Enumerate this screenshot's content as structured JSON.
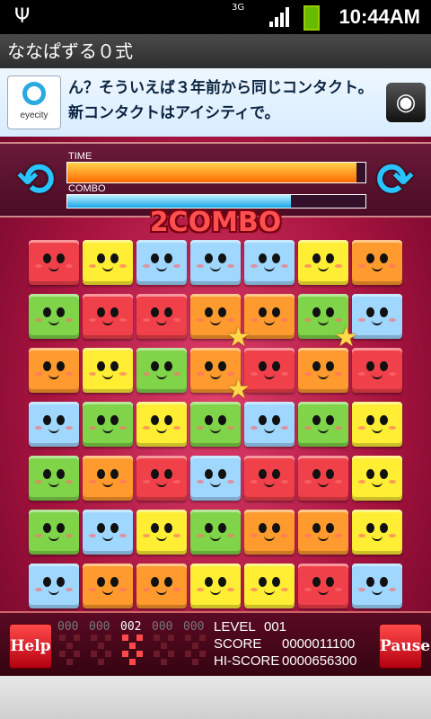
{
  "status_bar": {
    "time": "10:44AM",
    "network": "3G"
  },
  "app": {
    "title": "ななぱずる０式"
  },
  "ad": {
    "logo_text": "eyecity",
    "message": "ん？そういえば３年前から同じコンタクト。新コンタクトはアイシティで。"
  },
  "hud": {
    "time_label": "TIME",
    "time_level": 0.97,
    "combo_label": "COMBO",
    "combo_level": 0.75
  },
  "combo_text": "2COMBO",
  "board": {
    "colors": {
      "red": "#f0404a",
      "yellow": "#ffee33",
      "blue": "#9fd7ff",
      "orange": "#ff9a2e",
      "green": "#7fd44a"
    },
    "rows": [
      [
        "red",
        "yellow",
        "blue",
        "blue",
        "blue",
        "yellow",
        "orange"
      ],
      [
        "green",
        "red",
        "red",
        "orange",
        "orange",
        "green",
        "blue"
      ],
      [
        "orange",
        "yellow",
        "green",
        "orange",
        "red",
        "orange",
        "red"
      ],
      [
        "blue",
        "green",
        "yellow",
        "green",
        "blue",
        "green",
        "yellow"
      ],
      [
        "green",
        "orange",
        "red",
        "blue",
        "red",
        "red",
        "yellow"
      ],
      [
        "green",
        "blue",
        "yellow",
        "green",
        "orange",
        "orange",
        "yellow"
      ],
      [
        "blue",
        "orange",
        "orange",
        "yellow",
        "yellow",
        "red",
        "blue"
      ]
    ]
  },
  "buttons": {
    "help": "Help",
    "pause": "Pause"
  },
  "counters": [
    {
      "label": "000",
      "active": false
    },
    {
      "label": "000",
      "active": false
    },
    {
      "label": "002",
      "active": true
    },
    {
      "label": "000",
      "active": false
    },
    {
      "label": "000",
      "active": false
    }
  ],
  "stats": {
    "level_label": "LEVEL",
    "level": "001",
    "score_label": "SCORE",
    "score": "0000011100",
    "hiscore_label": "HI-SCORE",
    "hiscore": "0000656300"
  }
}
